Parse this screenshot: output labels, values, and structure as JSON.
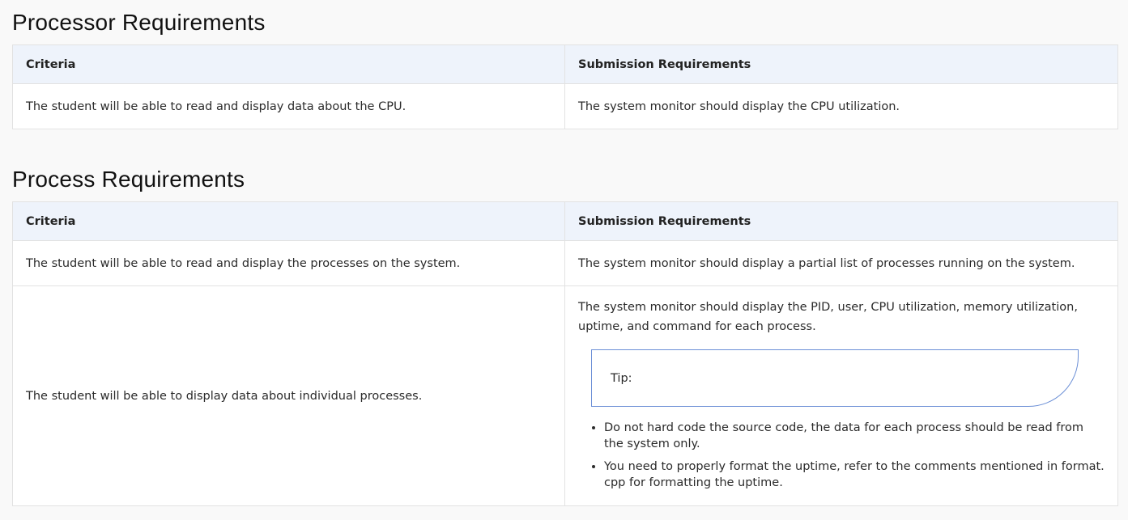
{
  "sections": [
    {
      "title": "Processor Requirements",
      "headers": [
        "Criteria",
        "Submission Requirements"
      ],
      "rows": [
        {
          "criteria": "The student will be able to read and display data about the CPU.",
          "submission": "The system monitor should display the CPU utilization."
        }
      ]
    },
    {
      "title": "Process Requirements",
      "headers": [
        "Criteria",
        "Submission Requirements"
      ],
      "rows": [
        {
          "criteria": "The student will be able to read and display the processes on the system.",
          "submission": "The system monitor should display a partial list of processes running on the system."
        },
        {
          "criteria": "The student will be able to display data about individual processes.",
          "submission": "The system monitor should display the PID, user, CPU utilization, memory utilization, uptime, and command for each process.",
          "tip_label": "Tip:",
          "bullets": [
            "Do not hard code the source code, the data for each process should be read from the system only.",
            "You need to properly format the uptime, refer to the comments mentioned in format. cpp for formatting the uptime."
          ]
        }
      ]
    }
  ],
  "colors": {
    "page_background": "#f9f9f9",
    "header_row_background": "#eef3fb",
    "table_border": "#e2e2e2",
    "tip_border": "#6b8fd6"
  }
}
